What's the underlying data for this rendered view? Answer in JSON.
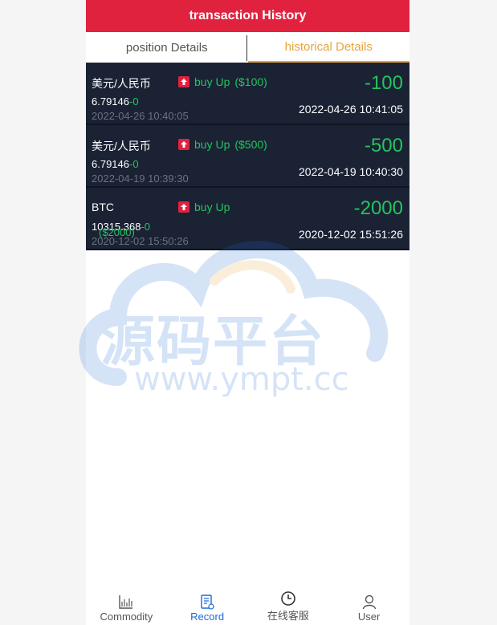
{
  "header": {
    "title": "transaction History"
  },
  "tabs": [
    {
      "label": "position Details"
    },
    {
      "label": "historical Details"
    }
  ],
  "records": [
    {
      "name": "美元/人民币",
      "direction": "buy Up",
      "amount": "($100)",
      "price": "6.79146",
      "change": "-0",
      "open_time": "2022-04-26 10:40:05",
      "pl": "-100",
      "close_time": "2022-04-26 10:41:05"
    },
    {
      "name": "美元/人民币",
      "direction": "buy Up",
      "amount": "($500)",
      "price": "6.79146",
      "change": "-0",
      "open_time": "2022-04-19 10:39:30",
      "pl": "-500",
      "close_time": "2022-04-19 10:40:30"
    },
    {
      "name": "BTC",
      "direction": "buy Up",
      "amount": "($2000)",
      "price": "10315.368",
      "change": "-0",
      "open_time": "2020-12-02 15:50:26",
      "pl": "-2000",
      "close_time": "2020-12-02 15:51:26"
    }
  ],
  "watermark": {
    "text": "源码平台",
    "url": "www.ympt.cc"
  },
  "nav": [
    {
      "label": "Commodity",
      "icon": "chart-icon"
    },
    {
      "label": "Record",
      "icon": "record-icon"
    },
    {
      "label": "在线客服",
      "icon": "clock-icon"
    },
    {
      "label": "User",
      "icon": "user-icon"
    }
  ],
  "colors": {
    "header": "#e1223f",
    "active_tab": "#e8a33b",
    "gain": "#22c55e",
    "row_bg": "#1a2234",
    "nav_active": "#1e6ad6"
  }
}
